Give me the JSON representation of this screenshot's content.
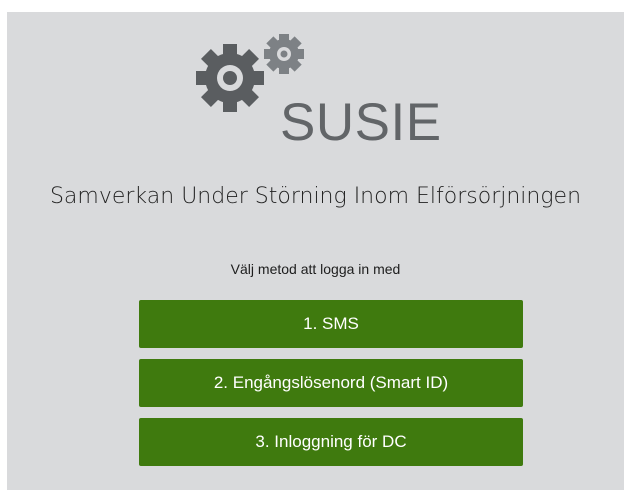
{
  "logo": {
    "wordmark": "SUSIE",
    "icon": "gears-icon"
  },
  "header": {
    "title": "Samverkan Under Störning Inom Elförsörjningen",
    "prompt": "Välj metod att logga in med"
  },
  "login_methods": [
    {
      "label": "1. SMS"
    },
    {
      "label": "2. Engångslösenord (Smart ID)"
    },
    {
      "label": "3. Inloggning för DC"
    }
  ],
  "colors": {
    "background": "#d9dadc",
    "button": "#3f7a0e",
    "gear_large": "#5a5d60",
    "gear_small": "#7d8185"
  }
}
